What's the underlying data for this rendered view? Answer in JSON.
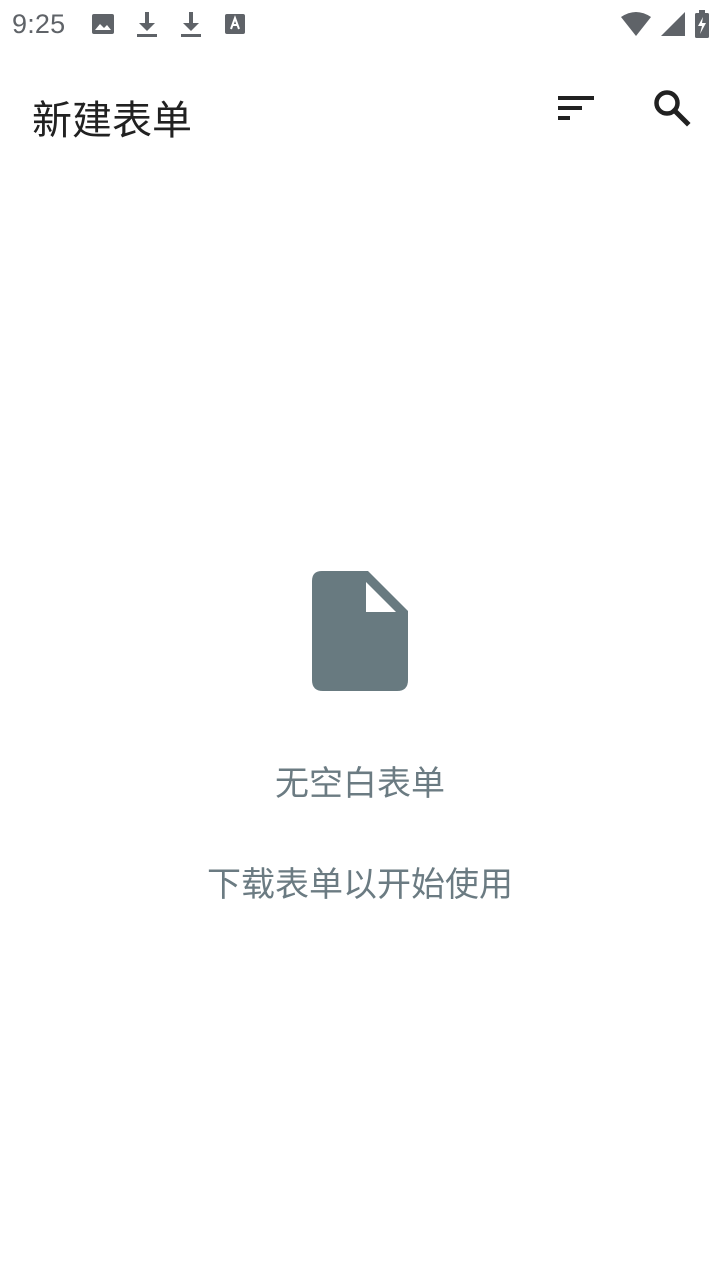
{
  "status_bar": {
    "time": "9:25",
    "left_icons": [
      "image-icon",
      "download-icon",
      "download-icon",
      "font-download-icon"
    ],
    "right_icons": [
      "wifi-icon",
      "signal-icon",
      "battery-charging-icon"
    ]
  },
  "app_bar": {
    "title": "新建表单",
    "actions": [
      "sort-icon",
      "search-icon"
    ]
  },
  "empty_state": {
    "icon": "document-icon",
    "title": "无空白表单",
    "subtitle": "下载表单以开始使用"
  },
  "colors": {
    "status_icon": "#5f6368",
    "title_text": "#212121",
    "empty_text": "#6b7b82",
    "doc_icon": "#687a80",
    "background": "#ffffff"
  }
}
